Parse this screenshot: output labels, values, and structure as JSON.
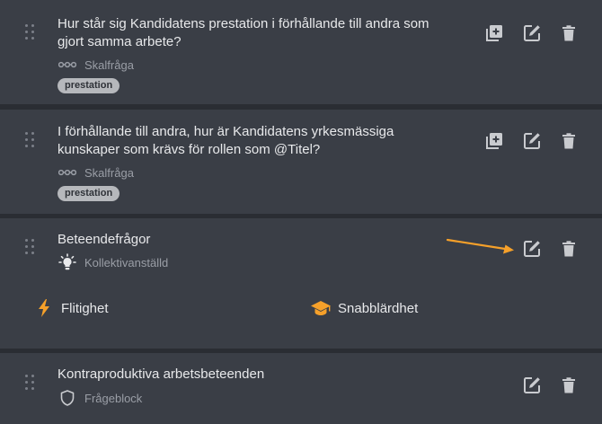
{
  "colors": {
    "background": "#2a2d33",
    "card": "#3a3e46",
    "text": "#e8e9eb",
    "muted": "#9a9ea6",
    "icon": "#c9cbcf",
    "accent_orange": "#f5a02a",
    "tag_bg": "#b6b8bc"
  },
  "questions": [
    {
      "title": "Hur står sig Kandidatens prestation i förhållande till andra som gjort samma arbete?",
      "type_icon": "scale-icon",
      "type_label": "Skalfråga",
      "tag": "prestation",
      "actions": [
        "add-copy-icon",
        "edit-icon",
        "trash-icon"
      ]
    },
    {
      "title": "I förhållande till andra, hur är Kandidatens yrkesmässiga kunskaper som krävs för rollen som @Titel?",
      "type_icon": "scale-icon",
      "type_label": "Skalfråga",
      "tag": "prestation",
      "actions": [
        "add-copy-icon",
        "edit-icon",
        "trash-icon"
      ]
    },
    {
      "title": "Beteendefrågor",
      "type_icon": "lightbulb-icon",
      "type_label": "Kollektivanställd",
      "competences": [
        {
          "icon": "lightning-icon",
          "label": "Flitighet"
        },
        {
          "icon": "graduation-cap-icon",
          "label": "Snabblärdhet"
        }
      ],
      "actions": [
        "edit-icon",
        "trash-icon"
      ],
      "annotation": "arrow-pointing-to-edit"
    },
    {
      "title": "Kontraproduktiva arbetsbeteenden",
      "type_icon": "shield-icon",
      "type_label": "Frågeblock",
      "actions": [
        "edit-icon",
        "trash-icon"
      ]
    }
  ]
}
